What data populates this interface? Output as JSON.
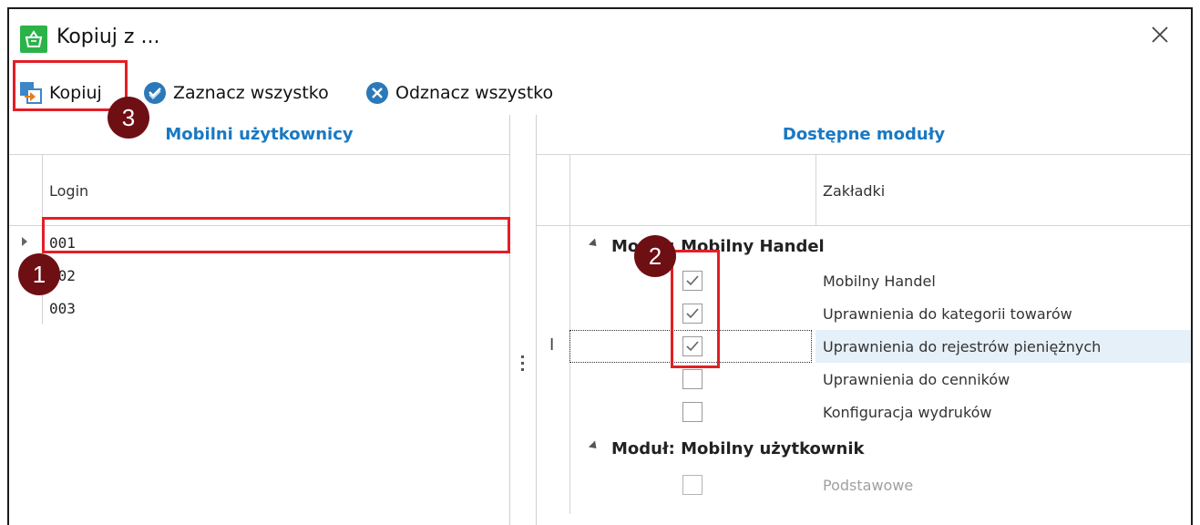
{
  "window": {
    "title": "Kopiuj z ..."
  },
  "toolbar": {
    "copy_label": "Kopiuj",
    "select_all_label": "Zaznacz wszystko",
    "deselect_all_label": "Odznacz wszystko"
  },
  "left_panel": {
    "header": "Mobilni użytkownicy",
    "column": "Login",
    "rows": [
      "001",
      "002",
      "003"
    ],
    "selected_row": "001"
  },
  "right_panel": {
    "header": "Dostępne moduły",
    "column": "Zakładki",
    "groups": [
      {
        "label": "Moduł: Mobilny Handel",
        "items": [
          {
            "label": "Mobilny Handel",
            "checked": true
          },
          {
            "label": "Uprawnienia do kategorii towarów",
            "checked": true
          },
          {
            "label": "Uprawnienia do rejestrów pieniężnych",
            "checked": true
          },
          {
            "label": "Uprawnienia do cenników",
            "checked": false
          },
          {
            "label": "Konfiguracja wydruków",
            "checked": false
          }
        ]
      },
      {
        "label": "Moduł: Mobilny użytkownik",
        "items": [
          {
            "label": "Podstawowe",
            "checked": false,
            "disabled": true
          }
        ]
      }
    ]
  },
  "annotations": {
    "badge1": "1",
    "badge2": "2",
    "badge3": "3"
  },
  "colors": {
    "accent": "#1a78c2",
    "highlight": "#e41e26",
    "badge": "#6e0f14",
    "app_icon": "#2bb34a",
    "selected_row": "#e6f0f8"
  }
}
